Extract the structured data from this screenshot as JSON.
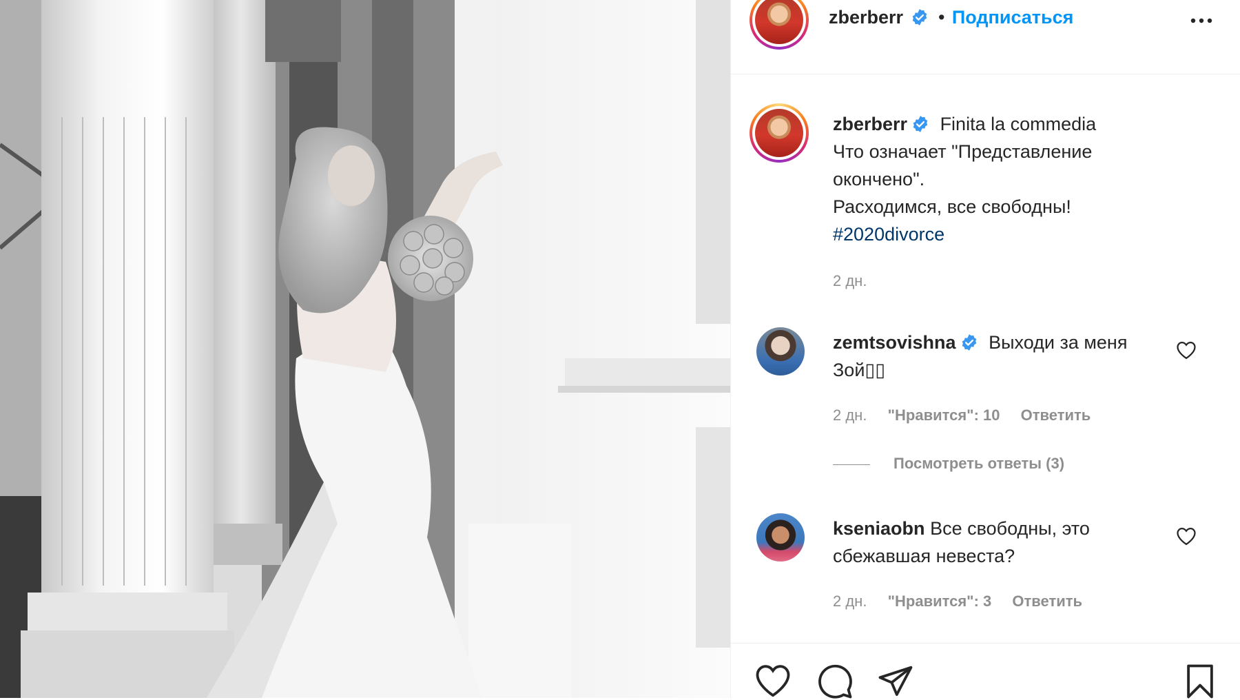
{
  "post": {
    "author": "zberberr",
    "follow_label": "Подписаться",
    "separator": "•",
    "caption_first": "Finita la commedia",
    "caption_lines": [
      "Что означает \"Представление",
      "окончено\".",
      "Расходимся, все свободны!"
    ],
    "hashtag": "#2020divorce",
    "time": "2 дн."
  },
  "comments": [
    {
      "user": "zemtsovishna",
      "verified": true,
      "text_line1": "Выходи за меня",
      "text_line2": "Зой▯▯",
      "time": "2 дн.",
      "likes": "\"Нравится\": 10",
      "reply": "Ответить",
      "view_replies": "Посмотреть ответы (3)"
    },
    {
      "user": "kseniaobn",
      "verified": false,
      "text_line1": "Все свободны, это",
      "text_line2": "сбежавшая невеста?",
      "time": "2 дн.",
      "likes": "\"Нравится\": 3",
      "reply": "Ответить"
    }
  ],
  "icons": {
    "verified": "verified-badge-icon",
    "more": "more-options-icon",
    "like": "heart-icon",
    "comment": "comment-icon",
    "share": "share-icon",
    "save": "bookmark-icon"
  },
  "colors": {
    "accent": "#0095f6",
    "verified": "#3897f0",
    "hashtag": "#00376b",
    "muted": "#8e8e8e"
  }
}
